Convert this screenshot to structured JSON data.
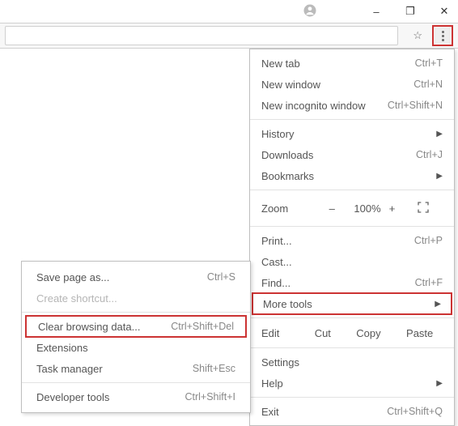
{
  "titlebar": {
    "minimize": "–",
    "maximize": "❐",
    "close": "✕"
  },
  "menu": {
    "new_tab": {
      "label": "New tab",
      "shortcut": "Ctrl+T"
    },
    "new_window": {
      "label": "New window",
      "shortcut": "Ctrl+N"
    },
    "new_incognito": {
      "label": "New incognito window",
      "shortcut": "Ctrl+Shift+N"
    },
    "history": {
      "label": "History"
    },
    "downloads": {
      "label": "Downloads",
      "shortcut": "Ctrl+J"
    },
    "bookmarks": {
      "label": "Bookmarks"
    },
    "zoom": {
      "label": "Zoom",
      "value": "100%",
      "minus": "–",
      "plus": "+"
    },
    "print": {
      "label": "Print...",
      "shortcut": "Ctrl+P"
    },
    "cast": {
      "label": "Cast..."
    },
    "find": {
      "label": "Find...",
      "shortcut": "Ctrl+F"
    },
    "more_tools": {
      "label": "More tools"
    },
    "edit": {
      "label": "Edit",
      "cut": "Cut",
      "copy": "Copy",
      "paste": "Paste"
    },
    "settings": {
      "label": "Settings"
    },
    "help": {
      "label": "Help"
    },
    "exit": {
      "label": "Exit",
      "shortcut": "Ctrl+Shift+Q"
    }
  },
  "submenu": {
    "save_page": {
      "label": "Save page as...",
      "shortcut": "Ctrl+S"
    },
    "create_shortcut": {
      "label": "Create shortcut..."
    },
    "clear_data": {
      "label": "Clear browsing data...",
      "shortcut": "Ctrl+Shift+Del"
    },
    "extensions": {
      "label": "Extensions"
    },
    "task_manager": {
      "label": "Task manager",
      "shortcut": "Shift+Esc"
    },
    "dev_tools": {
      "label": "Developer tools",
      "shortcut": "Ctrl+Shift+I"
    }
  }
}
